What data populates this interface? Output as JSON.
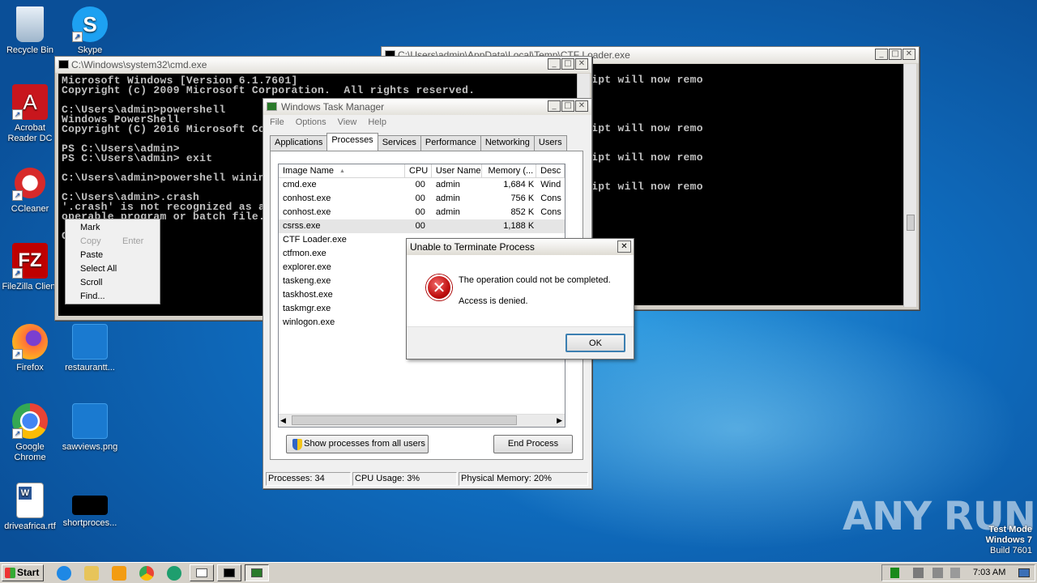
{
  "desktop": {
    "icons": [
      {
        "label": "Recycle Bin"
      },
      {
        "label": "Skype"
      },
      {
        "label": "Acrobat Reader DC"
      },
      {
        "label": "CCleaner"
      },
      {
        "label": "FileZilla Client"
      },
      {
        "label": "Firefox"
      },
      {
        "label": "restaurantt..."
      },
      {
        "label": "Google Chrome"
      },
      {
        "label": "sawviews.png"
      },
      {
        "label": "driveafrica.rtf"
      },
      {
        "label": "shortproces..."
      }
    ]
  },
  "cmd_window": {
    "title": "C:\\Windows\\system32\\cmd.exe",
    "lines": [
      "Microsoft Windows [Version 6.1.7601]",
      "Copyright (c) 2009 Microsoft Corporation.  All rights reserved.",
      "",
      "C:\\Users\\admin>powershell",
      "Windows PowerShell",
      "Copyright (C) 2016 Microsoft Corporation. All rights reserved.",
      "",
      "PS C:\\Users\\admin>",
      "PS C:\\Users\\admin> exit",
      "",
      "C:\\Users\\admin>powershell winini",
      "",
      "C:\\Users\\admin>.crash",
      "'.crash' is not recognized as an internal or external command,",
      "operable program or batch file.",
      "",
      "C"
    ]
  },
  "context_menu": {
    "items": [
      {
        "label": "Mark",
        "enabled": true
      },
      {
        "label": "Copy",
        "accel": "Enter",
        "enabled": false
      },
      {
        "label": "Paste",
        "enabled": true
      },
      {
        "label": "Select All",
        "enabled": true
      },
      {
        "label": "Scroll",
        "enabled": true
      },
      {
        "label": "Find...",
        "enabled": true
      }
    ]
  },
  "ctf_window": {
    "title": "C:\\Users\\admin\\AppData\\Local\\Temp\\CTF Loader.exe",
    "lines": [
      "21.17:62984..",
      " to host has been lost, NanoScript will now remo",
      "e host.",
      "21.17:62984..",
      "",
      "",
      " to host has been lost, NanoScript will now remo",
      "e host.",
      "21.17:62984..",
      " to host has been lost, NanoScript will now remo",
      "e host.",
      "21.17:62984..",
      " to host has been lost, NanoScript will now remo",
      "",
      "21.17:62984.."
    ]
  },
  "task_manager": {
    "title": "Windows Task Manager",
    "menu": [
      "File",
      "Options",
      "View",
      "Help"
    ],
    "tabs": [
      "Applications",
      "Processes",
      "Services",
      "Performance",
      "Networking",
      "Users"
    ],
    "selected_tab": "Processes",
    "columns": [
      "Image Name",
      "CPU",
      "User Name",
      "Memory (...",
      "Desc"
    ],
    "rows": [
      {
        "name": "cmd.exe",
        "cpu": "00",
        "user": "admin",
        "mem": "1,684 K",
        "desc": "Wind"
      },
      {
        "name": "conhost.exe",
        "cpu": "00",
        "user": "admin",
        "mem": "756 K",
        "desc": "Cons"
      },
      {
        "name": "conhost.exe",
        "cpu": "00",
        "user": "admin",
        "mem": "852 K",
        "desc": "Cons"
      },
      {
        "name": "csrss.exe",
        "cpu": "00",
        "user": "",
        "mem": "1,188 K",
        "desc": ""
      },
      {
        "name": "CTF Loader.exe",
        "cpu": "",
        "user": "",
        "mem": "",
        "desc": ""
      },
      {
        "name": "ctfmon.exe",
        "cpu": "",
        "user": "",
        "mem": "",
        "desc": ""
      },
      {
        "name": "explorer.exe",
        "cpu": "",
        "user": "",
        "mem": "",
        "desc": ""
      },
      {
        "name": "taskeng.exe",
        "cpu": "",
        "user": "",
        "mem": "",
        "desc": ""
      },
      {
        "name": "taskhost.exe",
        "cpu": "",
        "user": "",
        "mem": "",
        "desc": ""
      },
      {
        "name": "taskmgr.exe",
        "cpu": "",
        "user": "",
        "mem": "",
        "desc": ""
      },
      {
        "name": "winlogon.exe",
        "cpu": "",
        "user": "",
        "mem": "",
        "desc": ""
      }
    ],
    "show_all_label": "Show processes from all users",
    "end_process_label": "End Process",
    "status": {
      "processes": "Processes: 34",
      "cpu": "CPU Usage: 3%",
      "memory": "Physical Memory: 20%"
    }
  },
  "dialog": {
    "title": "Unable to Terminate Process",
    "message": "The operation could not be completed.",
    "detail": "Access is denied.",
    "ok_label": "OK"
  },
  "taskbar": {
    "start_label": "Start",
    "clock": "7:03 AM"
  },
  "watermark": {
    "brand": "ANY RUN",
    "line1": "Test Mode",
    "line2": "Windows 7",
    "line3": "Build 7601"
  }
}
